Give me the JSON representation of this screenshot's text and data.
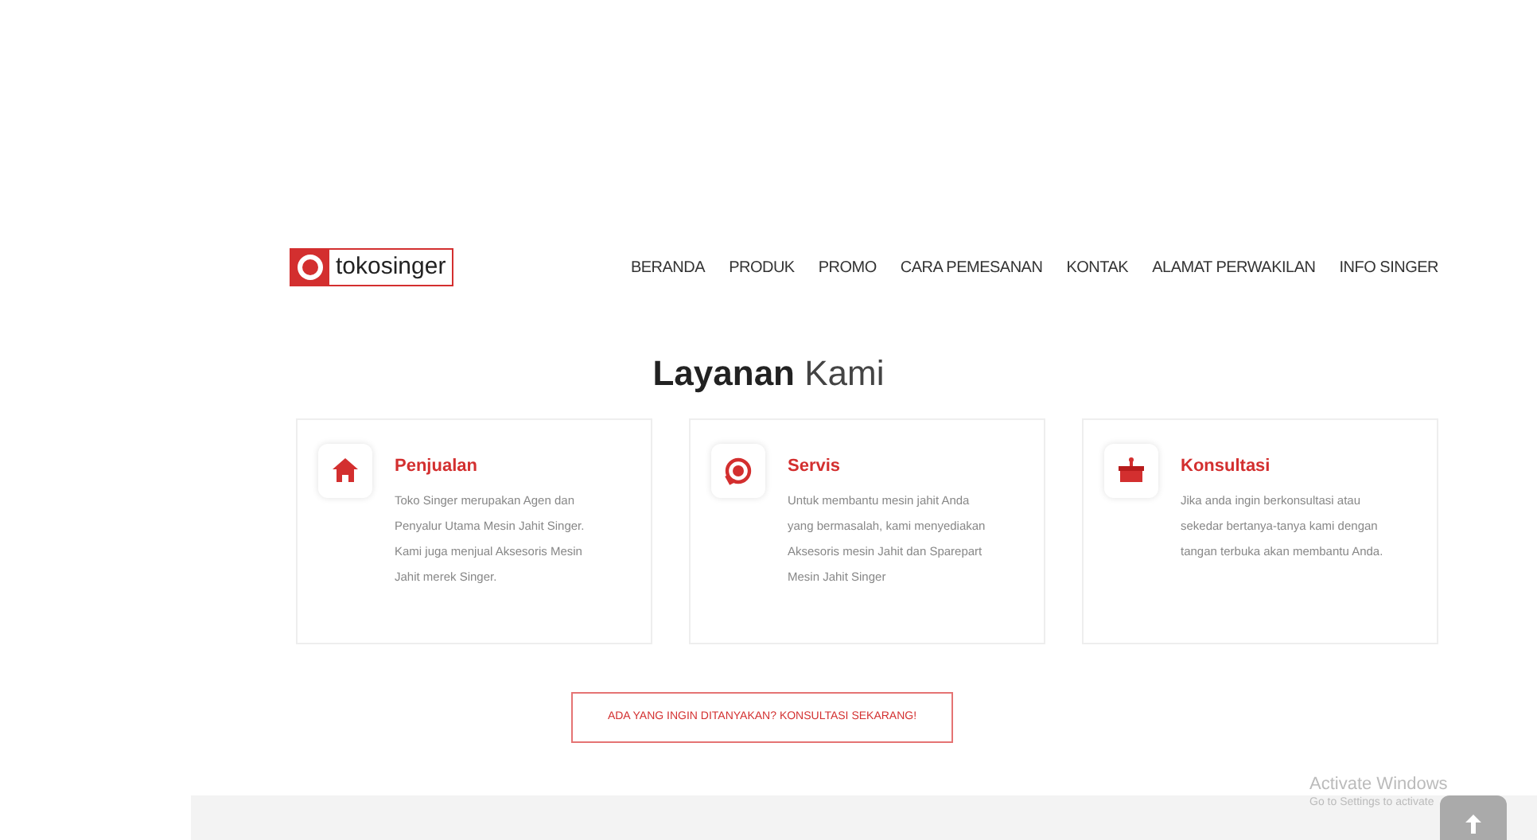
{
  "logo": {
    "text": "tokosinger"
  },
  "nav": [
    {
      "label": "BERANDA"
    },
    {
      "label": "PRODUK"
    },
    {
      "label": "PROMO"
    },
    {
      "label": "CARA PEMESANAN"
    },
    {
      "label": "KONTAK"
    },
    {
      "label": "ALAMAT PERWAKILAN"
    },
    {
      "label": "INFO SINGER"
    }
  ],
  "heading": {
    "bold": "Layanan",
    "rest": "Kami"
  },
  "services": [
    {
      "kind": "house",
      "title": "Penjualan",
      "text": "Toko Singer merupakan Agen dan Penyalur Utama Mesin Jahit Singer. Kami juga menjual Aksesoris Mesin Jahit merek Singer."
    },
    {
      "kind": "phone24",
      "title": "Servis",
      "text": "Untuk membantu mesin jahit Anda yang bermasalah, kami menyediakan Aksesoris mesin Jahit dan Sparepart Mesin Jahit Singer"
    },
    {
      "kind": "gift",
      "title": "Konsultasi",
      "text": "Jika anda ingin berkonsultasi atau sekedar bertanya-tanya kami dengan tangan terbuka akan membantu Anda."
    }
  ],
  "cta": {
    "label": "ADA YANG INGIN DITANYAKAN? KONSULTASI SEKARANG!"
  },
  "activation": {
    "title": "Activate Windows",
    "subtitle": "Go to Settings to activate"
  }
}
